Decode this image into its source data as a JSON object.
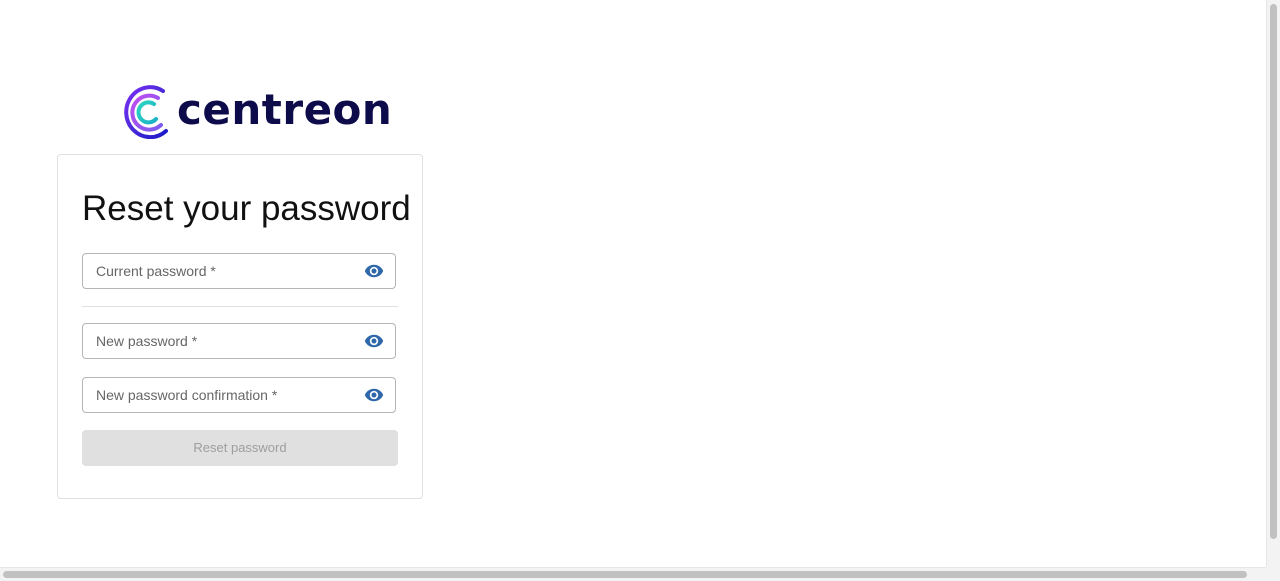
{
  "brand": {
    "name": "centreon",
    "logo_icon": "centreon-logo-icon"
  },
  "form": {
    "title": "Reset your password",
    "fields": [
      {
        "label": "Current password *",
        "icon": "eye-icon"
      },
      {
        "label": "New password *",
        "icon": "eye-icon"
      },
      {
        "label": "New password confirmation *",
        "icon": "eye-icon"
      }
    ],
    "submit_label": "Reset password"
  },
  "colors": {
    "accent": "#2e68aa",
    "brand_text": "#0d0b4a",
    "button_disabled_bg": "#e0e0e0",
    "button_disabled_text": "#9e9e9e"
  }
}
